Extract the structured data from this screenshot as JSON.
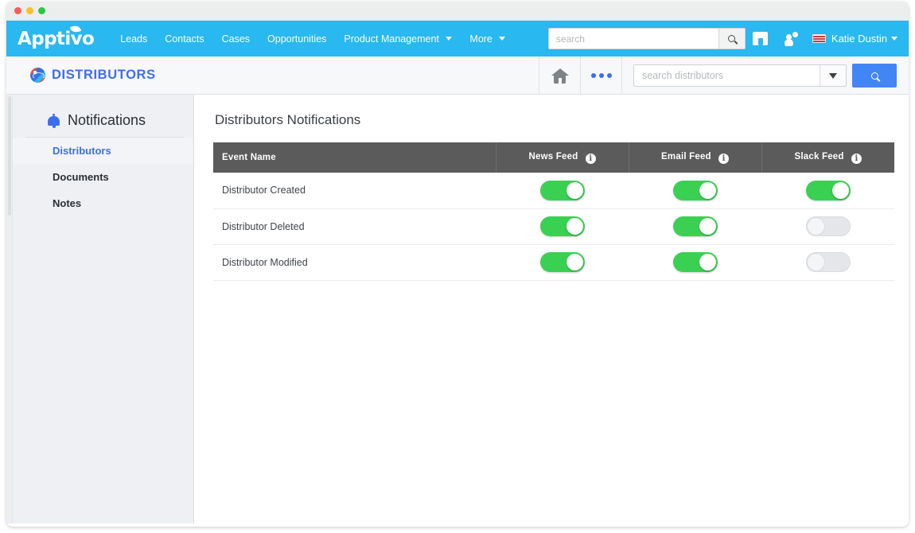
{
  "window": {
    "traffic_lights": [
      "close",
      "minimize",
      "maximize"
    ]
  },
  "topnav": {
    "logo": "Apptivo",
    "links": [
      {
        "label": "Leads",
        "dropdown": false
      },
      {
        "label": "Contacts",
        "dropdown": false
      },
      {
        "label": "Cases",
        "dropdown": false
      },
      {
        "label": "Opportunities",
        "dropdown": false
      },
      {
        "label": "Product Management",
        "dropdown": true
      },
      {
        "label": "More",
        "dropdown": true
      }
    ],
    "search": {
      "value": "",
      "placeholder": "search"
    },
    "icons": [
      "store-icon",
      "user-notification-icon",
      "flag-icon"
    ],
    "user": "Katie Dustin"
  },
  "appbar": {
    "app_icon": "globe-icon",
    "app_name": "DISTRIBUTORS",
    "home_icon": "home-icon",
    "more_icon": "ellipsis-icon",
    "search": {
      "value": "",
      "placeholder": "search distributors"
    },
    "search_button_icon": "search-icon",
    "dropdown_icon": "chevron-down-icon",
    "accent": "#4285f4"
  },
  "sidebar": {
    "header": {
      "icon": "bell-icon",
      "title": "Notifications"
    },
    "items": [
      {
        "label": "Distributors",
        "active": true
      },
      {
        "label": "Documents",
        "active": false
      },
      {
        "label": "Notes",
        "active": false
      }
    ]
  },
  "main": {
    "title": "Distributors Notifications",
    "table": {
      "columns": [
        {
          "label": "Event Name",
          "info": false
        },
        {
          "label": "News Feed",
          "info": true
        },
        {
          "label": "Email Feed",
          "info": true
        },
        {
          "label": "Slack Feed",
          "info": true
        }
      ],
      "rows": [
        {
          "event": "Distributor Created",
          "news_feed": true,
          "email_feed": true,
          "slack_feed": true
        },
        {
          "event": "Distributor Deleted",
          "news_feed": true,
          "email_feed": true,
          "slack_feed": false
        },
        {
          "event": "Distributor Modified",
          "news_feed": true,
          "email_feed": true,
          "slack_feed": false
        }
      ]
    }
  },
  "colors": {
    "brand_blue": "#29b8ef",
    "link_blue": "#3d6ef0",
    "toggle_on": "#3ad152",
    "toggle_off": "#e4e6ea",
    "table_header": "#5b5b5b"
  }
}
